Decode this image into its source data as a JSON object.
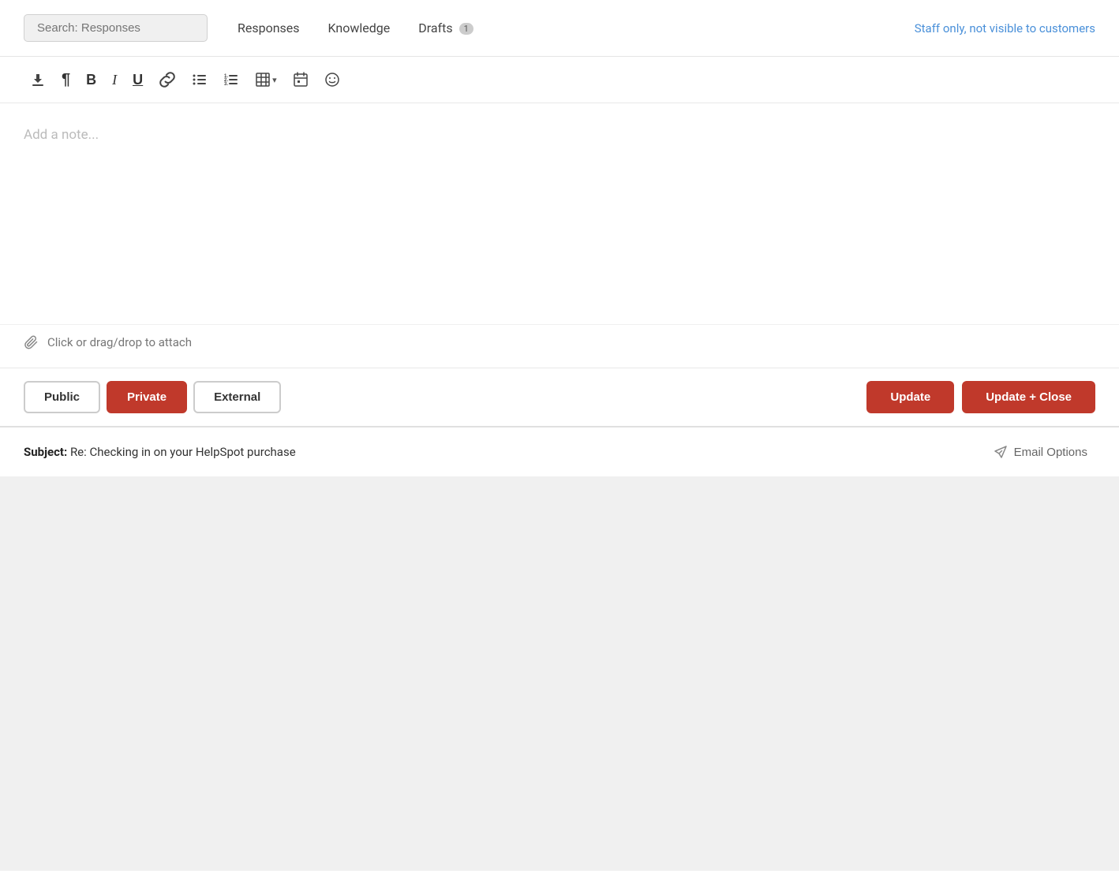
{
  "topbar": {
    "search_placeholder": "Search: Responses",
    "staff_notice": "Staff only, not visible to customers",
    "tabs": [
      {
        "id": "responses",
        "label": "Responses",
        "badge": null
      },
      {
        "id": "knowledge",
        "label": "Knowledge",
        "badge": null
      },
      {
        "id": "drafts",
        "label": "Drafts",
        "badge": "1"
      }
    ]
  },
  "toolbar": {
    "buttons": [
      {
        "id": "save",
        "symbol": "⬇",
        "title": "Save"
      },
      {
        "id": "paragraph",
        "symbol": "¶",
        "title": "Paragraph"
      },
      {
        "id": "bold",
        "symbol": "B",
        "title": "Bold"
      },
      {
        "id": "italic",
        "symbol": "I",
        "title": "Italic"
      },
      {
        "id": "underline",
        "symbol": "U",
        "title": "Underline"
      },
      {
        "id": "link",
        "symbol": "🔗",
        "title": "Link"
      },
      {
        "id": "bullet-list",
        "symbol": "☰",
        "title": "Bullet List"
      },
      {
        "id": "numbered-list",
        "symbol": "≡",
        "title": "Numbered List"
      },
      {
        "id": "table",
        "symbol": "▦",
        "title": "Table"
      },
      {
        "id": "calendar",
        "symbol": "📋",
        "title": "Insert Date"
      },
      {
        "id": "emoji",
        "symbol": "🙂",
        "title": "Emoji"
      }
    ],
    "table_dropdown_symbol": "▾"
  },
  "editor": {
    "placeholder": "Add a note..."
  },
  "attach": {
    "label": "Click or drag/drop to attach",
    "icon": "🔗"
  },
  "action_bar": {
    "visibility_buttons": [
      {
        "id": "public",
        "label": "Public",
        "active": false
      },
      {
        "id": "private",
        "label": "Private",
        "active": true
      },
      {
        "id": "external",
        "label": "External",
        "active": false
      }
    ],
    "update_label": "Update",
    "update_close_label": "Update + Close"
  },
  "subject_bar": {
    "subject_label": "Subject:",
    "subject_value": "Re: Checking in on your HelpSpot purchase",
    "email_options_label": "Email Options"
  },
  "colors": {
    "accent_red": "#c0392b",
    "link_blue": "#4a90d9"
  }
}
